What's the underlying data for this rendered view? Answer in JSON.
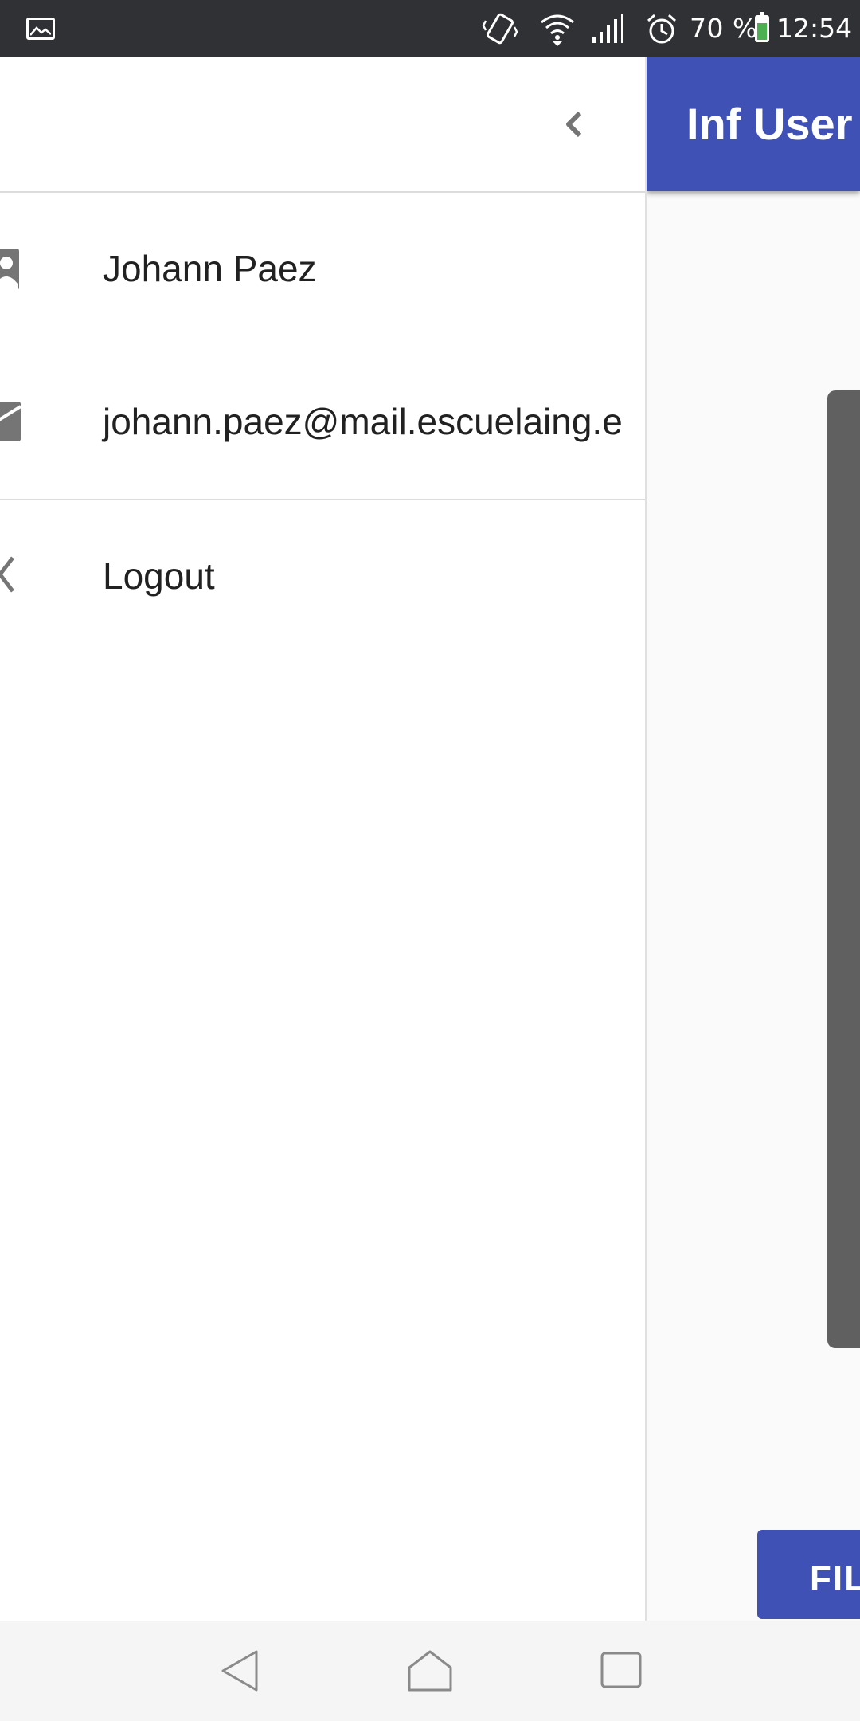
{
  "status_bar": {
    "battery_percent": "70 %",
    "time": "12:54",
    "icons": [
      "gallery-icon",
      "vibrate-icon",
      "wifi-icon",
      "signal-icon",
      "alarm-icon",
      "battery-icon"
    ],
    "battery_level": 0.7
  },
  "app": {
    "title": "Inf User",
    "fill_button_label": "FIL",
    "accent_color": "#3f51b5"
  },
  "drawer": {
    "collapse_icon": "chevron-left-icon",
    "items": [
      {
        "label": "Johann Paez",
        "icon": "person-icon"
      },
      {
        "label": "johann.paez@mail.escuelaing.e",
        "icon": "email-icon"
      },
      {
        "label": "Logout",
        "icon": "back-chevron-icon"
      }
    ]
  },
  "nav_bar": {
    "buttons": [
      "back-icon",
      "home-icon",
      "recents-icon"
    ]
  }
}
